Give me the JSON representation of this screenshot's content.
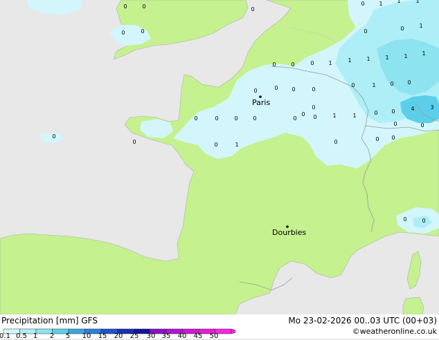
{
  "title": "Precipitation [mm] GFS",
  "valid_time": "Mo 23-02-2026 00..03 UTC (00+03)",
  "credit": "©weatheronline.co.uk",
  "legend": {
    "ticks": [
      "0.1",
      "0.5",
      "1",
      "2",
      "5",
      "10",
      "15",
      "20",
      "25",
      "30",
      "35",
      "40",
      "45",
      "50"
    ],
    "colors": [
      "#d2f6fb",
      "#aeeef7",
      "#8ee3f0",
      "#5bcfe9",
      "#3aa6e0",
      "#2c7fdb",
      "#1e52cf",
      "#1a2fb6",
      "#13149c",
      "#8a10c6",
      "#b412d6",
      "#d016d8",
      "#e81ad6",
      "#f425e4"
    ]
  },
  "map": {
    "land_color": "#c5f18e",
    "sea_color": "#e8e8e8",
    "rain_light_color": "#d2f6fb",
    "rain_moderate_color": "#aeeef7",
    "rain_heavy_color": "#8ee3f0",
    "rain_core_color": "#5bcfe9",
    "border_color": "#a0a0a0",
    "cities": [
      {
        "id": "paris",
        "name": "Paris"
      },
      {
        "id": "dourbies",
        "name": "Dourbies"
      }
    ],
    "values": [
      "0",
      "0",
      "0",
      "0",
      "0",
      "0",
      "0",
      "0",
      "1",
      "0",
      "0",
      "1",
      "0",
      "0",
      "0",
      "0",
      "0",
      "0",
      "0",
      "0",
      "1",
      "1",
      "1",
      "0",
      "0",
      "1",
      "1",
      "1",
      "1",
      "1",
      "1",
      "0",
      "1",
      "0",
      "1",
      "1",
      "4",
      "3",
      "0",
      "0",
      "0",
      "0",
      "0",
      "0",
      "0",
      "0",
      "0",
      "0",
      "0",
      "0",
      "0",
      "0",
      "0",
      "0"
    ]
  }
}
